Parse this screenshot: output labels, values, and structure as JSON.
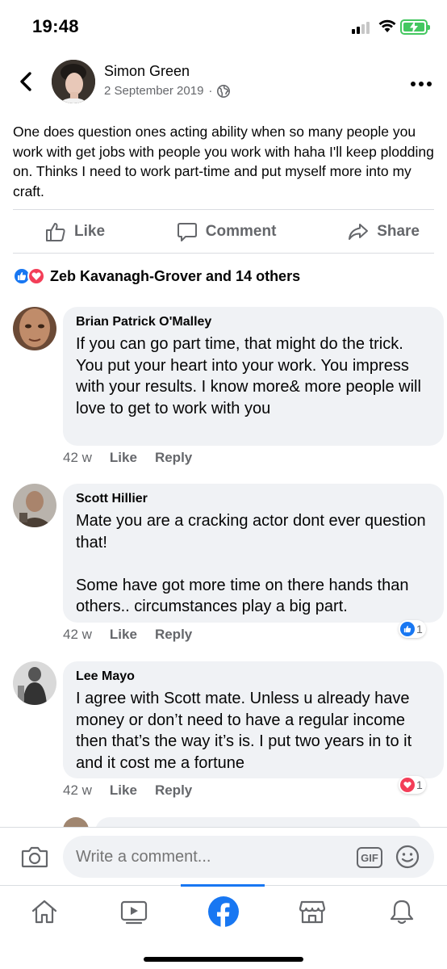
{
  "status_bar": {
    "time": "19:48"
  },
  "post": {
    "author": "Simon Green",
    "date": "2 September 2019",
    "separator": "·",
    "audience_icon": "globe-icon",
    "text": "One does question ones acting ability when so many people you work with get jobs with people you work with haha I'll keep plodding on. Thinks I need to work part-time and put myself more into my craft.",
    "actions": {
      "like": "Like",
      "comment": "Comment",
      "share": "Share"
    },
    "reactions_text": "Zeb Kavanagh-Grover and 14 others"
  },
  "comments": [
    {
      "name": "Brian Patrick O'Malley",
      "text": "If you can go part time, that might do the trick. You put your heart into your work. You impress with your results. I know more& more people will love to get to work with you",
      "time": "42 w",
      "like": "Like",
      "reply": "Reply"
    },
    {
      "name": "Scott Hillier",
      "text": "Mate you are a cracking actor dont ever question that!\n\nSome have got more time on there hands than others.. circumstances play a big part.",
      "time": "42 w",
      "like": "Like",
      "reply": "Reply",
      "reaction": {
        "type": "like",
        "count": "1"
      }
    },
    {
      "name": "Lee Mayo",
      "text": "I agree with Scott mate. Unless u already have money or don’t need to have a regular income then that’s the way it’s is. I put two years in to it and it cost me a fortune",
      "time": "42 w",
      "like": "Like",
      "reply": "Reply",
      "reaction": {
        "type": "love",
        "count": "1"
      }
    }
  ],
  "composer": {
    "placeholder": "Write a comment...",
    "gif_label": "GIF"
  },
  "tabs": [
    "home-icon",
    "watch-icon",
    "facebook-icon",
    "marketplace-icon",
    "notifications-icon"
  ],
  "colors": {
    "accent": "#1877f2",
    "love": "#f33e58",
    "secondary_text": "#65676b",
    "bubble": "#f0f2f5",
    "battery": "#44c760"
  }
}
